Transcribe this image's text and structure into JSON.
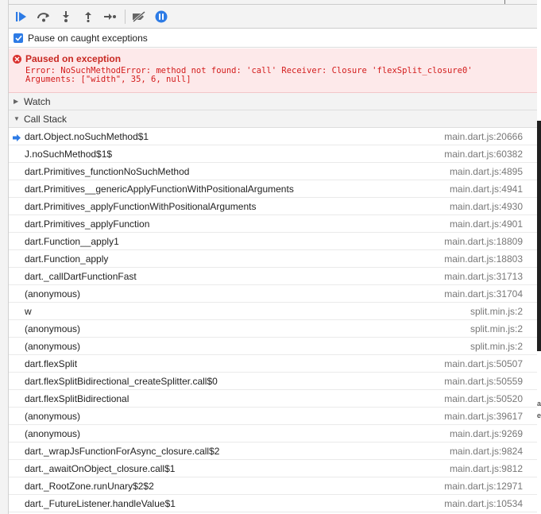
{
  "toolbar": {
    "buttons": [
      {
        "name": "resume-button",
        "icon": "resume-icon"
      },
      {
        "name": "step-over-button",
        "icon": "step-over-icon"
      },
      {
        "name": "step-into-button",
        "icon": "step-into-icon"
      },
      {
        "name": "step-out-button",
        "icon": "step-out-icon"
      },
      {
        "name": "step-button",
        "icon": "step-icon"
      },
      {
        "name": "deactivate-breakpoints-button",
        "icon": "deactivate-breakpoints-icon"
      },
      {
        "name": "pause-on-exceptions-button",
        "icon": "pause-icon"
      }
    ],
    "accent": "#2d7be5"
  },
  "pause_on_caught": {
    "label": "Pause on caught exceptions",
    "checked": true
  },
  "exception": {
    "title": "Paused on exception",
    "message": "Error: NoSuchMethodError: method not found: 'call' Receiver: Closure 'flexSplit_closure0'\nArguments: [\"width\", 35, 6, null]",
    "color": "#c82822"
  },
  "watch": {
    "label": "Watch",
    "expanded": false
  },
  "call_stack": {
    "label": "Call Stack",
    "expanded": true,
    "frames": [
      {
        "fn": "dart.Object.noSuchMethod$1",
        "loc": "main.dart.js:20666",
        "current": true
      },
      {
        "fn": "J.noSuchMethod$1$",
        "loc": "main.dart.js:60382"
      },
      {
        "fn": "dart.Primitives_functionNoSuchMethod",
        "loc": "main.dart.js:4895"
      },
      {
        "fn": "dart.Primitives__genericApplyFunctionWithPositionalArguments",
        "loc": "main.dart.js:4941"
      },
      {
        "fn": "dart.Primitives_applyFunctionWithPositionalArguments",
        "loc": "main.dart.js:4930"
      },
      {
        "fn": "dart.Primitives_applyFunction",
        "loc": "main.dart.js:4901"
      },
      {
        "fn": "dart.Function__apply1",
        "loc": "main.dart.js:18809"
      },
      {
        "fn": "dart.Function_apply",
        "loc": "main.dart.js:18803"
      },
      {
        "fn": "dart._callDartFunctionFast",
        "loc": "main.dart.js:31713"
      },
      {
        "fn": "(anonymous)",
        "loc": "main.dart.js:31704"
      },
      {
        "fn": "w",
        "loc": "split.min.js:2"
      },
      {
        "fn": "(anonymous)",
        "loc": "split.min.js:2"
      },
      {
        "fn": "(anonymous)",
        "loc": "split.min.js:2"
      },
      {
        "fn": "dart.flexSplit",
        "loc": "main.dart.js:50507"
      },
      {
        "fn": "dart.flexSplitBidirectional_createSplitter.call$0",
        "loc": "main.dart.js:50559"
      },
      {
        "fn": "dart.flexSplitBidirectional",
        "loc": "main.dart.js:50520"
      },
      {
        "fn": "(anonymous)",
        "loc": "main.dart.js:39617"
      },
      {
        "fn": "(anonymous)",
        "loc": "main.dart.js:9269"
      },
      {
        "fn": "dart._wrapJsFunctionForAsync_closure.call$2",
        "loc": "main.dart.js:9824"
      },
      {
        "fn": "dart._awaitOnObject_closure.call$1",
        "loc": "main.dart.js:9812"
      },
      {
        "fn": "dart._RootZone.runUnary$2$2",
        "loc": "main.dart.js:12971"
      },
      {
        "fn": "dart._FutureListener.handleValue$1",
        "loc": "main.dart.js:10534"
      }
    ]
  },
  "edge_marks": [
    "t",
    "a",
    "e"
  ]
}
